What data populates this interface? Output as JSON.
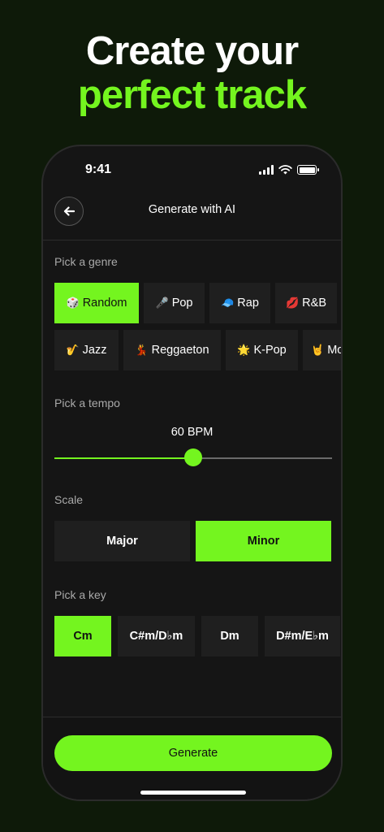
{
  "headline": {
    "line1": "Create your",
    "line2": "perfect track"
  },
  "status": {
    "time": "9:41"
  },
  "nav": {
    "title": "Generate with AI"
  },
  "genre": {
    "label": "Pick a genre",
    "row1": [
      {
        "emoji": "🎲",
        "label": "Random",
        "selected": true
      },
      {
        "emoji": "🎤",
        "label": "Pop",
        "selected": false
      },
      {
        "emoji": "🧢",
        "label": "Rap",
        "selected": false
      },
      {
        "emoji": "💋",
        "label": "R&B",
        "selected": false
      }
    ],
    "row2": [
      {
        "emoji": "🎷",
        "label": "Jazz",
        "selected": false
      },
      {
        "emoji": "💃",
        "label": "Reggaeton",
        "selected": false
      },
      {
        "emoji": "🌟",
        "label": "K-Pop",
        "selected": false
      },
      {
        "emoji": "🤘",
        "label": "Mo",
        "selected": false
      }
    ]
  },
  "tempo": {
    "label": "Pick a tempo",
    "value_text": "60 BPM",
    "level": 0.5
  },
  "scale": {
    "label": "Scale",
    "options": [
      "Major",
      "Minor"
    ],
    "selected": "Minor"
  },
  "key": {
    "label": "Pick a key",
    "options": [
      "Cm",
      "C#m/D♭m",
      "Dm",
      "D#m/E♭m"
    ],
    "selected": "Cm"
  },
  "generate_label": "Generate",
  "colors": {
    "accent": "#74f51f",
    "background": "#0e1a09",
    "surface": "#151515",
    "chip": "#1f1f1f"
  }
}
